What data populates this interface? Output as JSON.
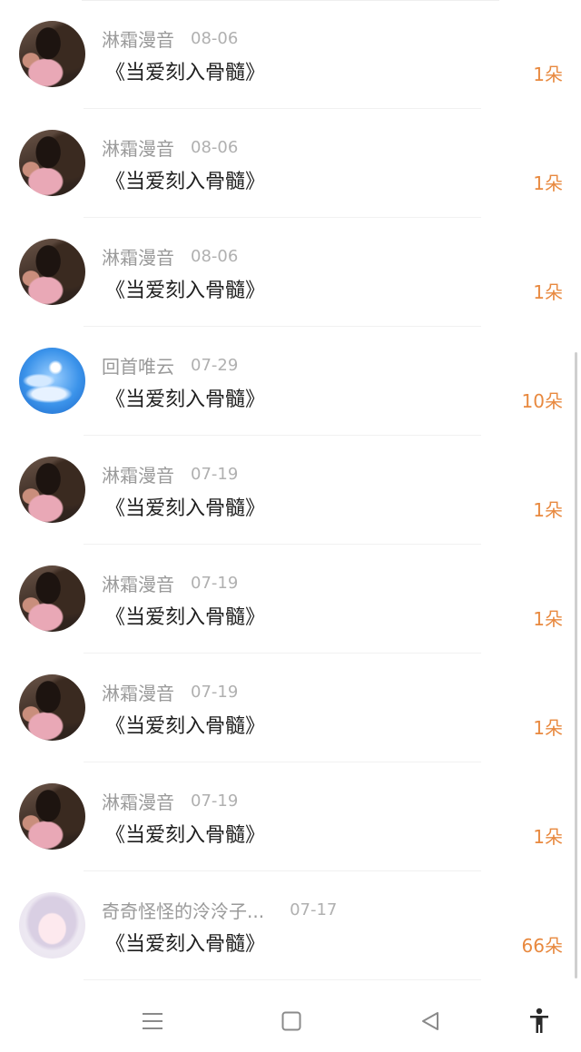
{
  "gift_list": [
    {
      "avatar": "person-photo",
      "name": "淋霜漫音",
      "date": "08-06",
      "work": "《当爱刻入骨髓》",
      "count": "1朵"
    },
    {
      "avatar": "person-photo",
      "name": "淋霜漫音",
      "date": "08-06",
      "work": "《当爱刻入骨髓》",
      "count": "1朵"
    },
    {
      "avatar": "person-photo",
      "name": "淋霜漫音",
      "date": "08-06",
      "work": "《当爱刻入骨髓》",
      "count": "1朵"
    },
    {
      "avatar": "sky-photo",
      "name": "回首唯云",
      "date": "07-29",
      "work": "《当爱刻入骨髓》",
      "count": "10朵"
    },
    {
      "avatar": "person-photo",
      "name": "淋霜漫音",
      "date": "07-19",
      "work": "《当爱刻入骨髓》",
      "count": "1朵"
    },
    {
      "avatar": "person-photo",
      "name": "淋霜漫音",
      "date": "07-19",
      "work": "《当爱刻入骨髓》",
      "count": "1朵"
    },
    {
      "avatar": "person-photo",
      "name": "淋霜漫音",
      "date": "07-19",
      "work": "《当爱刻入骨髓》",
      "count": "1朵"
    },
    {
      "avatar": "person-photo",
      "name": "淋霜漫音",
      "date": "07-19",
      "work": "《当爱刻入骨髓》",
      "count": "1朵"
    },
    {
      "avatar": "anime-illustration",
      "name": "奇奇怪怪的泠泠子...",
      "date": "07-17",
      "work": "《当爱刻入骨髓》",
      "count": "66朵"
    }
  ],
  "nav": {
    "menu_icon": "menu-icon",
    "home_icon": "square-home-icon",
    "back_icon": "triangle-back-icon",
    "accessibility_icon": "accessibility-icon"
  },
  "colors": {
    "count": "#e8893f",
    "name": "#9a9a9a",
    "title": "#1f1f1f"
  }
}
